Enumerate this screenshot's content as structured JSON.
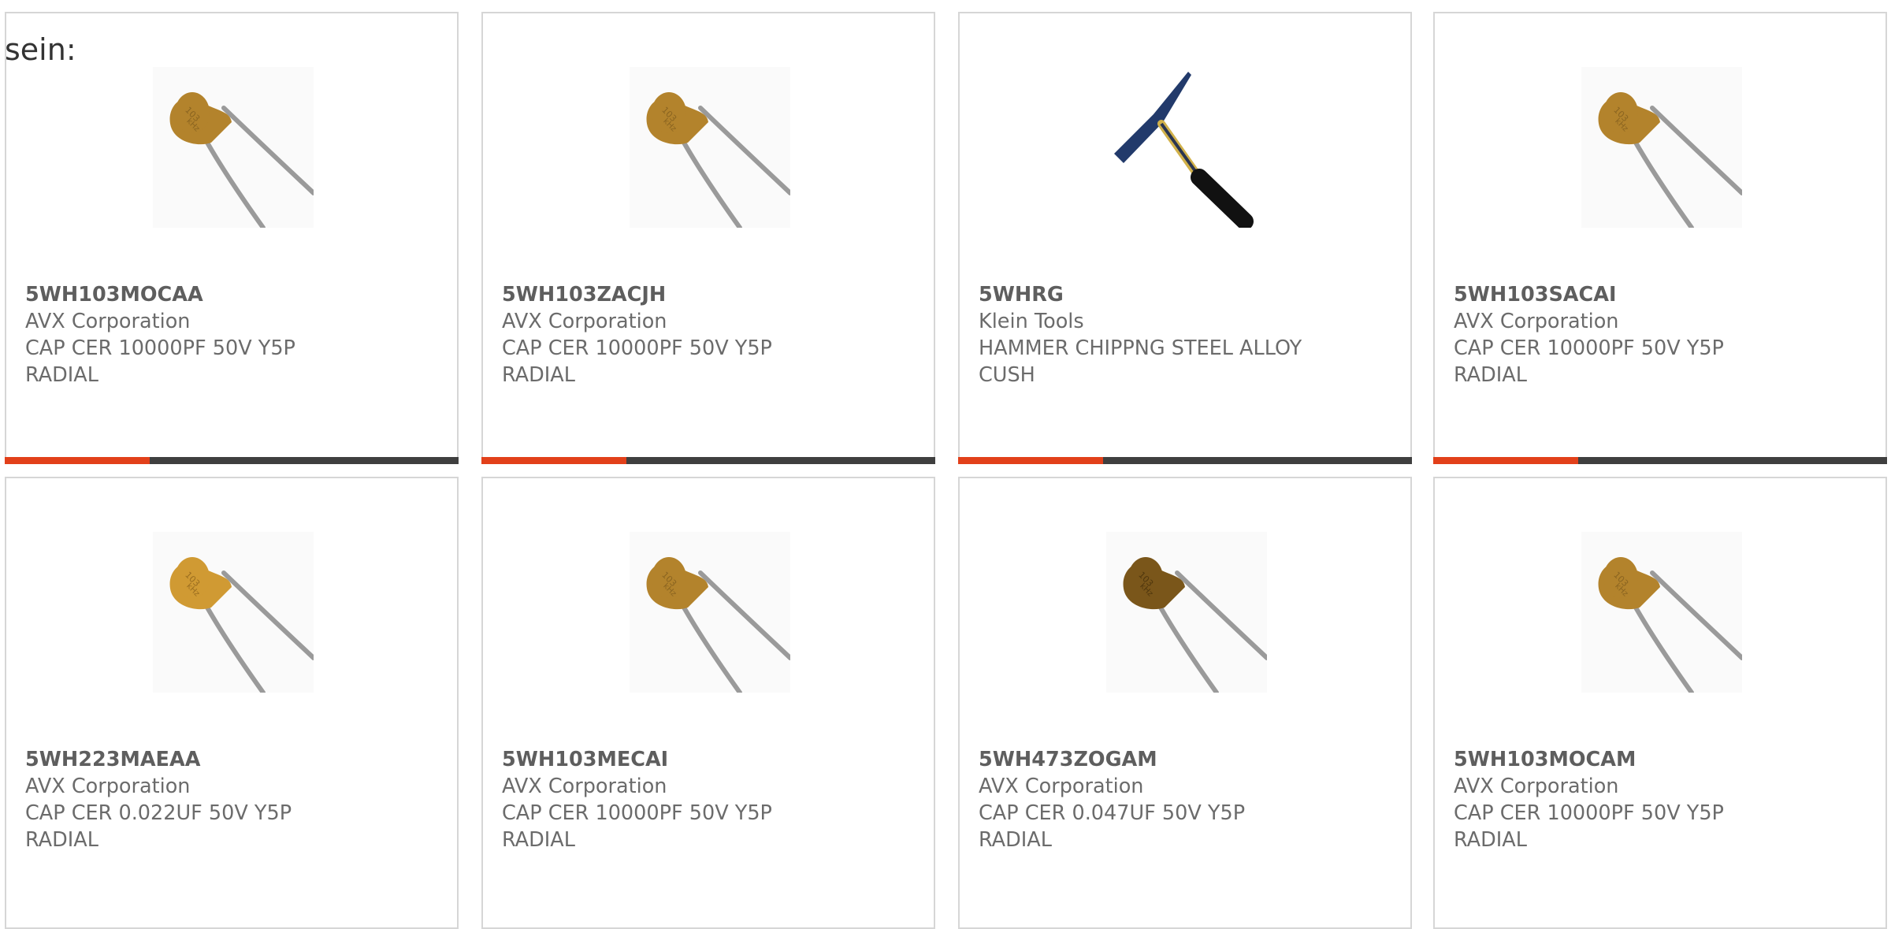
{
  "header": {
    "label": "sein:"
  },
  "colors": {
    "accent": "#e2401a",
    "bar_track": "#3f3f3f",
    "border": "#d6d6d6",
    "text": "#6b6b6b"
  },
  "products": [
    {
      "part_number": "5WH103MOCAA",
      "manufacturer": "AVX Corporation",
      "description_line1": "CAP CER 10000PF 50V Y5P",
      "description_line2": "RADIAL",
      "image": "capacitor-103",
      "progress": 0.32
    },
    {
      "part_number": "5WH103ZACJH",
      "manufacturer": "AVX Corporation",
      "description_line1": "CAP CER 10000PF 50V Y5P",
      "description_line2": "RADIAL",
      "image": "capacitor-103",
      "progress": 0.32
    },
    {
      "part_number": "5WHRG",
      "manufacturer": "Klein Tools",
      "description_line1": "HAMMER CHIPPNG STEEL ALLOY",
      "description_line2": "CUSH",
      "image": "chipping-hammer",
      "progress": 0.32
    },
    {
      "part_number": "5WH103SACAI",
      "manufacturer": "AVX Corporation",
      "description_line1": "CAP CER 10000PF 50V Y5P",
      "description_line2": "RADIAL",
      "image": "capacitor-103",
      "progress": 0.32
    },
    {
      "part_number": "5WH223MAEAA",
      "manufacturer": "AVX Corporation",
      "description_line1": "CAP CER 0.022UF 50V Y5P",
      "description_line2": "RADIAL",
      "image": "capacitor-light",
      "progress": null
    },
    {
      "part_number": "5WH103MECAI",
      "manufacturer": "AVX Corporation",
      "description_line1": "CAP CER 10000PF 50V Y5P",
      "description_line2": "RADIAL",
      "image": "capacitor-103",
      "progress": null
    },
    {
      "part_number": "5WH473ZOGAM",
      "manufacturer": "AVX Corporation",
      "description_line1": "CAP CER 0.047UF 50V Y5P",
      "description_line2": "RADIAL",
      "image": "capacitor-dark",
      "progress": null
    },
    {
      "part_number": "5WH103MOCAM",
      "manufacturer": "AVX Corporation",
      "description_line1": "CAP CER 10000PF 50V Y5P",
      "description_line2": "RADIAL",
      "image": "capacitor-103",
      "progress": null
    }
  ]
}
